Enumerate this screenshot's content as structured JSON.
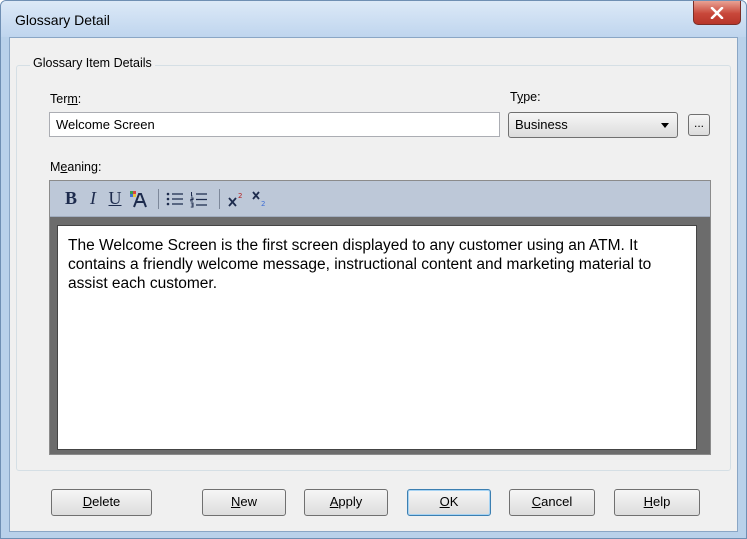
{
  "window": {
    "title": "Glossary Detail"
  },
  "group": {
    "legend": "Glossary Item Details"
  },
  "term": {
    "label_prefix": "Ter",
    "label_mnemonic": "m",
    "label_suffix": ":",
    "value": "Welcome Screen"
  },
  "type": {
    "label_prefix": "T",
    "label_mnemonic": "y",
    "label_suffix": "pe:",
    "selected": "Business",
    "browse_label": "..."
  },
  "meaning": {
    "label_prefix": "M",
    "label_mnemonic": "e",
    "label_suffix": "aning:",
    "text": "The Welcome Screen is the first screen displayed to any customer using an ATM.  It contains a friendly welcome message, instructional content and marketing material to assist each customer."
  },
  "toolbar": {
    "bold": "B",
    "italic": "I",
    "underline": "U",
    "icons": [
      "font-color-icon",
      "bullet-list-icon",
      "numbered-list-icon",
      "superscript-icon",
      "subscript-icon"
    ]
  },
  "buttons": {
    "delete": {
      "mnemonic": "D",
      "rest": "elete"
    },
    "new": {
      "mnemonic": "N",
      "rest": "ew"
    },
    "apply": {
      "mnemonic": "A",
      "rest": "pply"
    },
    "ok": {
      "mnemonic": "O",
      "rest": "K"
    },
    "cancel": {
      "mnemonic": "C",
      "rest": "ancel"
    },
    "help": {
      "mnemonic": "H",
      "rest": "elp"
    }
  },
  "colors": {
    "title_bg": "#bfd5ee",
    "close_button": "#c8473a",
    "toolbar_bg": "#bdc8d8",
    "dialog_bg": "#f0f0f0"
  }
}
